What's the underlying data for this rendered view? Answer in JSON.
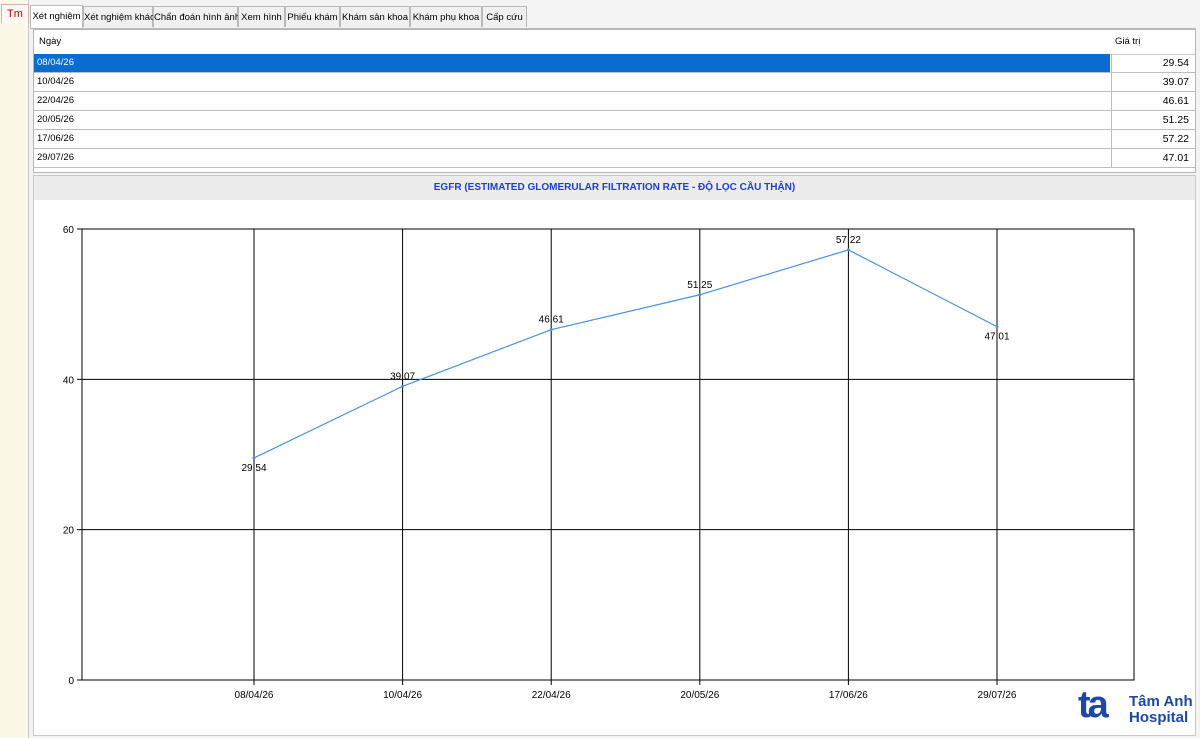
{
  "side_tab": {
    "label": "Tm"
  },
  "tabs": [
    {
      "label": "Xét nghiệm"
    },
    {
      "label": "Xét nghiệm khác"
    },
    {
      "label": "Chẩn đoán hình ảnh"
    },
    {
      "label": "Xem hình"
    },
    {
      "label": "Phiếu khám"
    },
    {
      "label": "Khám sản khoa"
    },
    {
      "label": "Khám phụ khoa"
    },
    {
      "label": "Cấp cứu"
    }
  ],
  "table": {
    "columns": [
      "Ngày",
      "Giá trị"
    ],
    "rows": [
      {
        "date": "08/04/26",
        "value": "29.54"
      },
      {
        "date": "10/04/26",
        "value": "39.07"
      },
      {
        "date": "22/04/26",
        "value": "46.61"
      },
      {
        "date": "20/05/26",
        "value": "51.25"
      },
      {
        "date": "17/06/26",
        "value": "57.22"
      },
      {
        "date": "29/07/26",
        "value": "47.01"
      }
    ]
  },
  "chart_data": {
    "type": "line",
    "title": "EGFR (ESTIMATED GLOMERULAR FILTRATION RATE - ĐỘ LỌC CẦU THẬN)",
    "categories": [
      "08/04/26",
      "10/04/26",
      "22/04/26",
      "20/05/26",
      "17/06/26",
      "29/07/26"
    ],
    "series": [
      {
        "values": [
          29.54,
          39.07,
          46.61,
          51.25,
          57.22,
          47.01
        ],
        "color": "#4a90e2"
      }
    ],
    "data_labels": [
      "29.54",
      "39.07",
      "46.61",
      "51.25",
      "57.22",
      "47.01"
    ],
    "yticks": [
      "0",
      "20",
      "40",
      "60"
    ],
    "ylim": [
      0,
      60
    ],
    "grid": true,
    "xlabel": "",
    "ylabel": ""
  },
  "logo": {
    "mark": "ta",
    "line1": "Tâm Anh",
    "line2": "Hospital"
  }
}
